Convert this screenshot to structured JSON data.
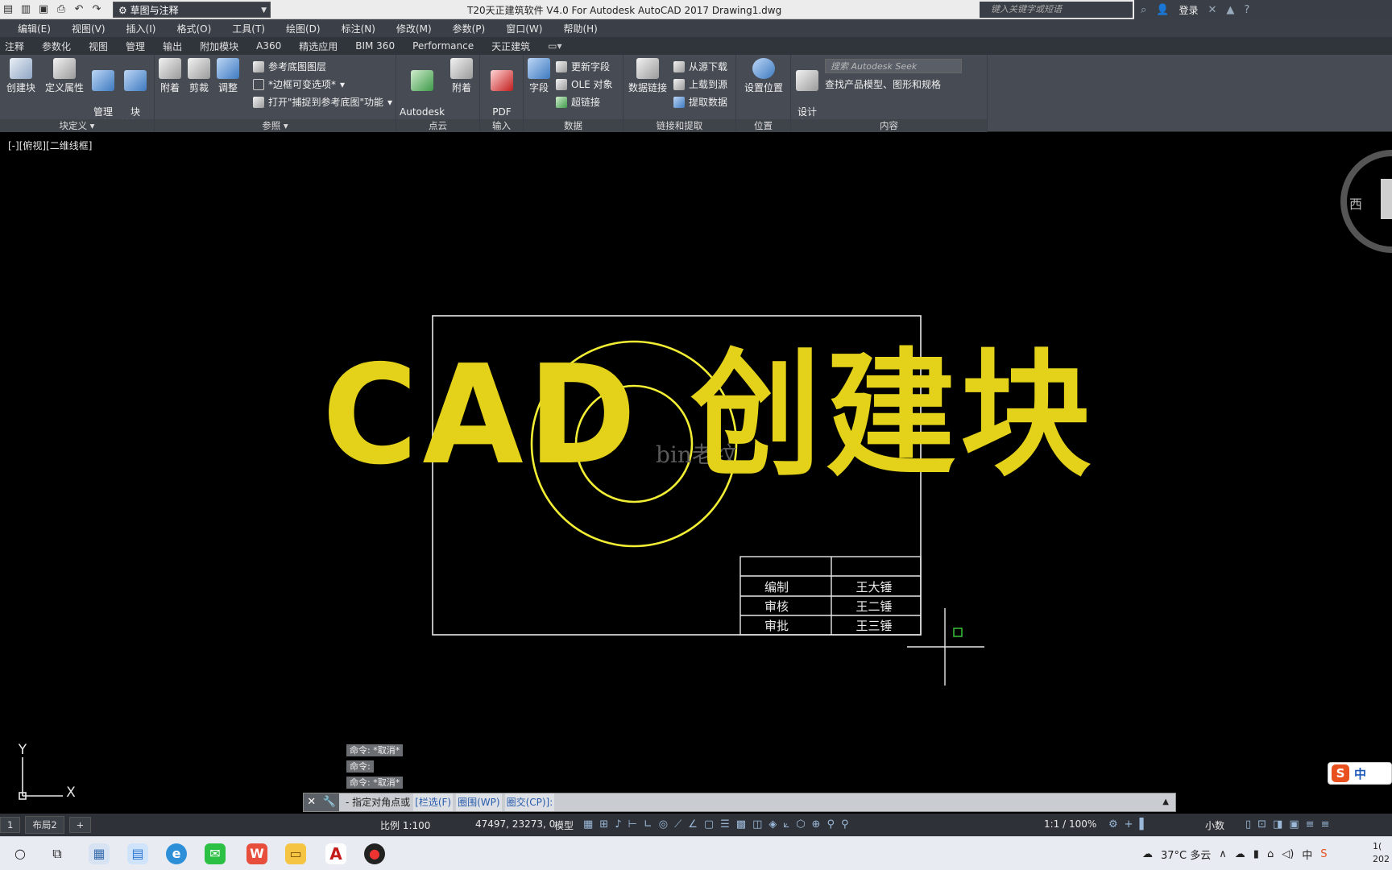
{
  "titlebar": {
    "workspace": "草图与注释",
    "app_title": "T20天正建筑软件 V4.0 For Autodesk AutoCAD 2017    Drawing1.dwg",
    "search_placeholder": "键入关键字或短语",
    "login": "登录"
  },
  "menu": [
    "编辑(E)",
    "视图(V)",
    "插入(I)",
    "格式(O)",
    "工具(T)",
    "绘图(D)",
    "标注(N)",
    "修改(M)",
    "参数(P)",
    "窗口(W)",
    "帮助(H)"
  ],
  "ribbon_tabs": [
    "注释",
    "参数化",
    "视图",
    "管理",
    "输出",
    "附加模块",
    "A360",
    "精选应用",
    "BIM 360",
    "Performance",
    "天正建筑"
  ],
  "ribbon": {
    "block_def": {
      "title": "块定义 ▾",
      "create": "创建块",
      "define_attr": "定义属性",
      "manage_attr": "管理\n属性",
      "block_editor": "块\n编辑器"
    },
    "reference": {
      "title": "参照 ▾",
      "attach": "附着",
      "clip": "剪裁",
      "adjust": "调整",
      "underlay_layers": "参考底图图层",
      "frames": "*边框可变选项*",
      "snap": "打开\"捕捉到参考底图\"功能"
    },
    "pointcloud": {
      "title": "点云",
      "recap": "Autodesk\nReCap",
      "attach": "附着"
    },
    "import": {
      "title": "输入",
      "pdf": "PDF\n输入"
    },
    "data": {
      "title": "数据",
      "field": "字段",
      "update_fields": "更新字段",
      "ole": "OLE 对象",
      "hyperlink": "超链接"
    },
    "link_extract": {
      "title": "链接和提取",
      "data_link": "数据链接",
      "download": "从源下载",
      "upload": "上载到源",
      "extract": "提取数据"
    },
    "location": {
      "title": "位置",
      "set_location": "设置位置"
    },
    "content": {
      "title": "内容",
      "design_center": "设计\n中心",
      "seek_placeholder": "搜索 Autodesk Seek",
      "seek_desc": "查找产品模型、图形和规格"
    }
  },
  "viewport_label": "[-][俯视][二维线框]",
  "overlay_title": "CAD 创建块",
  "watermark": "bin老纹",
  "title_block": {
    "rows": [
      {
        "label": "编制",
        "name": "王大锤"
      },
      {
        "label": "审核",
        "name": "王二锤"
      },
      {
        "label": "审批",
        "name": "王三锤"
      }
    ]
  },
  "command_history": [
    "命令: *取消*",
    "命令:",
    "命令: *取消*"
  ],
  "command_line": {
    "prompt": "- 指定对角点或",
    "options": [
      "[栏选(F)",
      "圈围(WP)",
      "圈交(CP)]:"
    ]
  },
  "status": {
    "layout_tabs": [
      "1",
      "布局2",
      "+"
    ],
    "scale": "比例 1:100",
    "coords": "47497, 23273, 0",
    "model": "模型",
    "annotation_scale": "1:1 / 100%",
    "units": "小数"
  },
  "axis": {
    "x": "X",
    "y": "Y"
  },
  "viewcube": "西",
  "taskbar": {
    "weather": "37°C  多云",
    "clock": "1(\n202"
  },
  "ime": {
    "s": "S",
    "lang": "中"
  },
  "colors": {
    "overlay_yellow": "#e4d21a",
    "circle_yellow": "#f2ee34",
    "canvas": "#000000",
    "ribbon": "#474c54"
  }
}
